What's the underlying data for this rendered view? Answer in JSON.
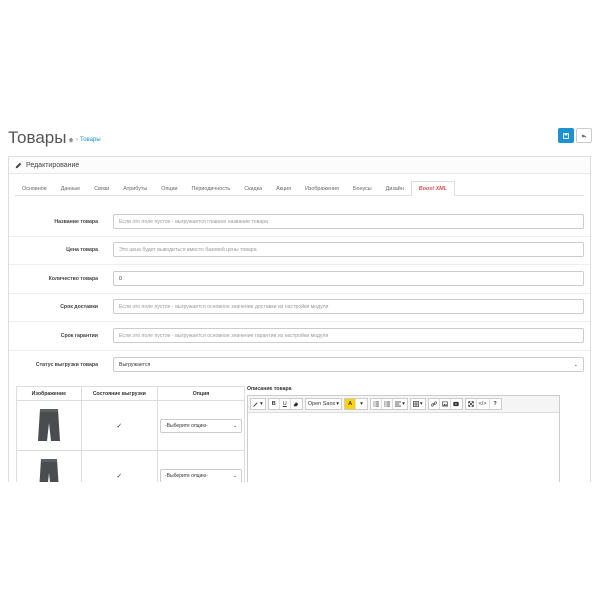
{
  "header": {
    "title": "Товары",
    "breadcrumb": "Товары"
  },
  "panel": {
    "heading": "Редактирование"
  },
  "tabs": [
    "Основное",
    "Данные",
    "Связи",
    "Атрибуты",
    "Опции",
    "Периодичность",
    "Скидка",
    "Акция",
    "Изображения",
    "Бонусы",
    "Дизайн",
    "Boost XML"
  ],
  "active_tab": "Boost XML",
  "form": {
    "name_label": "Название товара",
    "name_placeholder": "Если это поле пустое - выгружается главное название товара",
    "price_label": "Цена товара",
    "price_placeholder": "Это цена будет выводиться вместо базовой цены товара",
    "qty_label": "Количество товара",
    "qty_value": "0",
    "delivery_label": "Срок доставки",
    "delivery_placeholder": "Если это поле пустое - выгружается основное значение доставки из настройки модуля",
    "warranty_label": "Срок гарантии",
    "warranty_placeholder": "Если это поле пустое - выгружается основное значение гарантии из настройки модуля",
    "status_label": "Статус выгрузки товара",
    "status_value": "Выгружается"
  },
  "options_table": {
    "headers": [
      "Изображение",
      "Состояние выгрузки",
      "Опция"
    ],
    "rows": [
      {
        "checked": "✓",
        "option": "-Выберите опцию-"
      },
      {
        "checked": "✓",
        "option": "-Выберите опцию-"
      }
    ]
  },
  "editor": {
    "label": "Описание товара",
    "font_name": "Open Sans"
  }
}
